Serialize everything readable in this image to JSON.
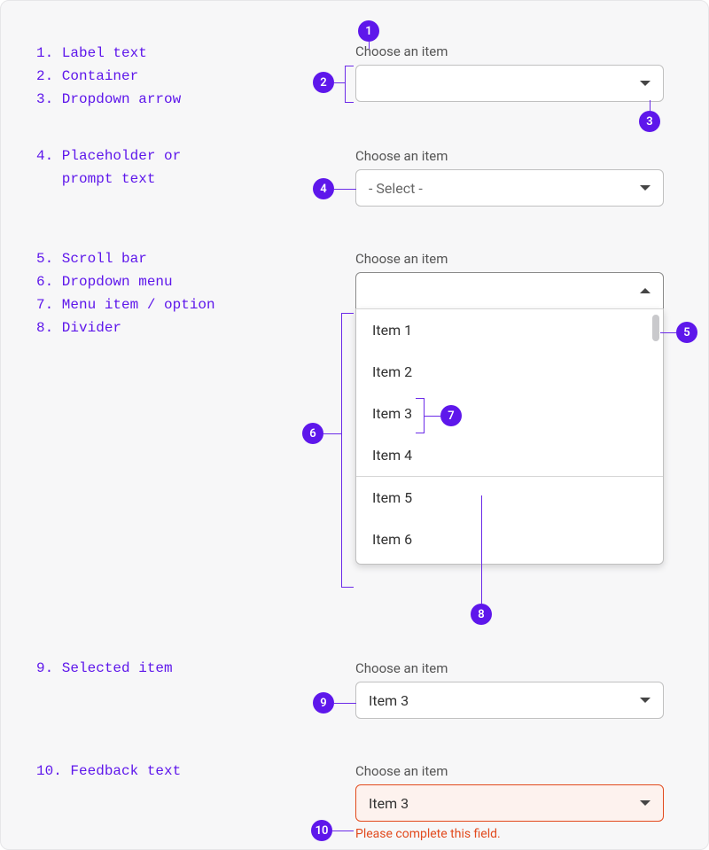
{
  "annotations": {
    "group1": "1. Label text\n2. Container\n3. Dropdown arrow",
    "group4": "4. Placeholder or\n   prompt text",
    "group5": "5. Scroll bar\n6. Dropdown menu\n7. Menu item / option\n8. Divider",
    "group9": "9. Selected item",
    "group10": "10. Feedback text"
  },
  "badges": {
    "b1": "1",
    "b2": "2",
    "b3": "3",
    "b4": "4",
    "b5": "5",
    "b6": "6",
    "b7": "7",
    "b8": "8",
    "b9": "9",
    "b10": "10"
  },
  "label": "Choose an item",
  "placeholder": "- Select -",
  "selected": "Item 3",
  "feedback": "Please complete this field.",
  "menu": {
    "group_a": [
      "Item 1",
      "Item 2",
      "Item 3",
      "Item 4"
    ],
    "group_b": [
      "Item 5",
      "Item 6"
    ]
  }
}
